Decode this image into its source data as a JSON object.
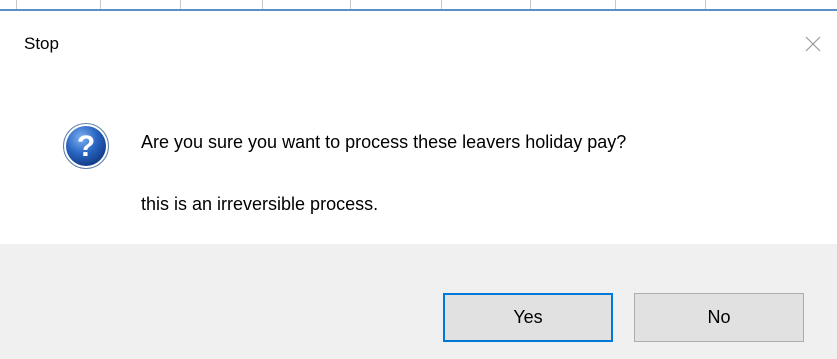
{
  "dialog": {
    "title": "Stop",
    "close_icon": "close-icon",
    "icon": "question-icon",
    "message_line1": "Are you sure you want to process these leavers holiday pay?",
    "message_line2": "this is an irreversible process.",
    "buttons": {
      "yes_label": "Yes",
      "no_label": "No"
    },
    "default_button": "yes"
  },
  "colors": {
    "dialog_background": "#ffffff",
    "footer_background": "#f0f0f0",
    "button_face": "#e1e1e1",
    "focus_border": "#0078d7",
    "icon_blue": "#1e5bb8"
  }
}
